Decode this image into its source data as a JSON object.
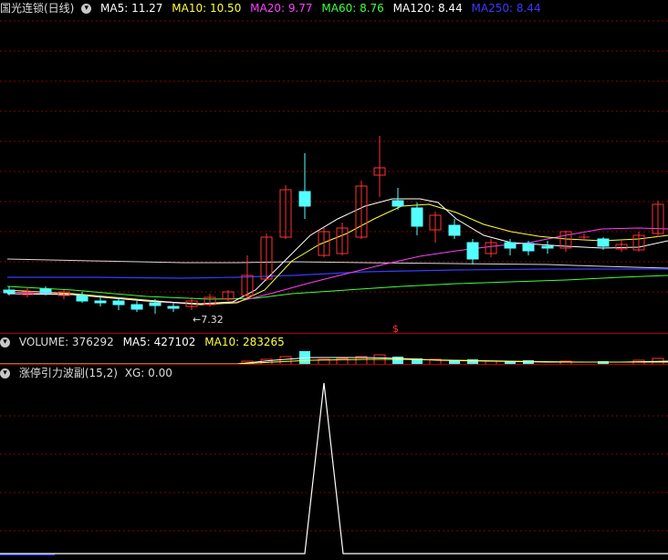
{
  "main": {
    "stock_name": "国光连锁(日线)",
    "ma": [
      {
        "label": "MA5: 11.27",
        "color": "#ffffff"
      },
      {
        "label": "MA10: 10.50",
        "color": "#ffff3c"
      },
      {
        "label": "MA20: 9.77",
        "color": "#ff40ff"
      },
      {
        "label": "MA60: 8.76",
        "color": "#40ff40"
      },
      {
        "label": "MA120: 8.44",
        "color": "#ffffff"
      },
      {
        "label": "MA250: 8.44",
        "color": "#3a3aff"
      }
    ],
    "low_marker": "←7.32",
    "signal_marker": "$"
  },
  "volume": {
    "title": "VOLUME: 376292",
    "ma5": "MA5: 427102",
    "ma10": "MA10: 283265"
  },
  "indicator": {
    "title": "涨停引力波副(15,2)",
    "xg": "XG: 0.00"
  },
  "colors": {
    "up": "#ff3232",
    "down": "#54ffff",
    "grid": "#8b0000"
  }
}
